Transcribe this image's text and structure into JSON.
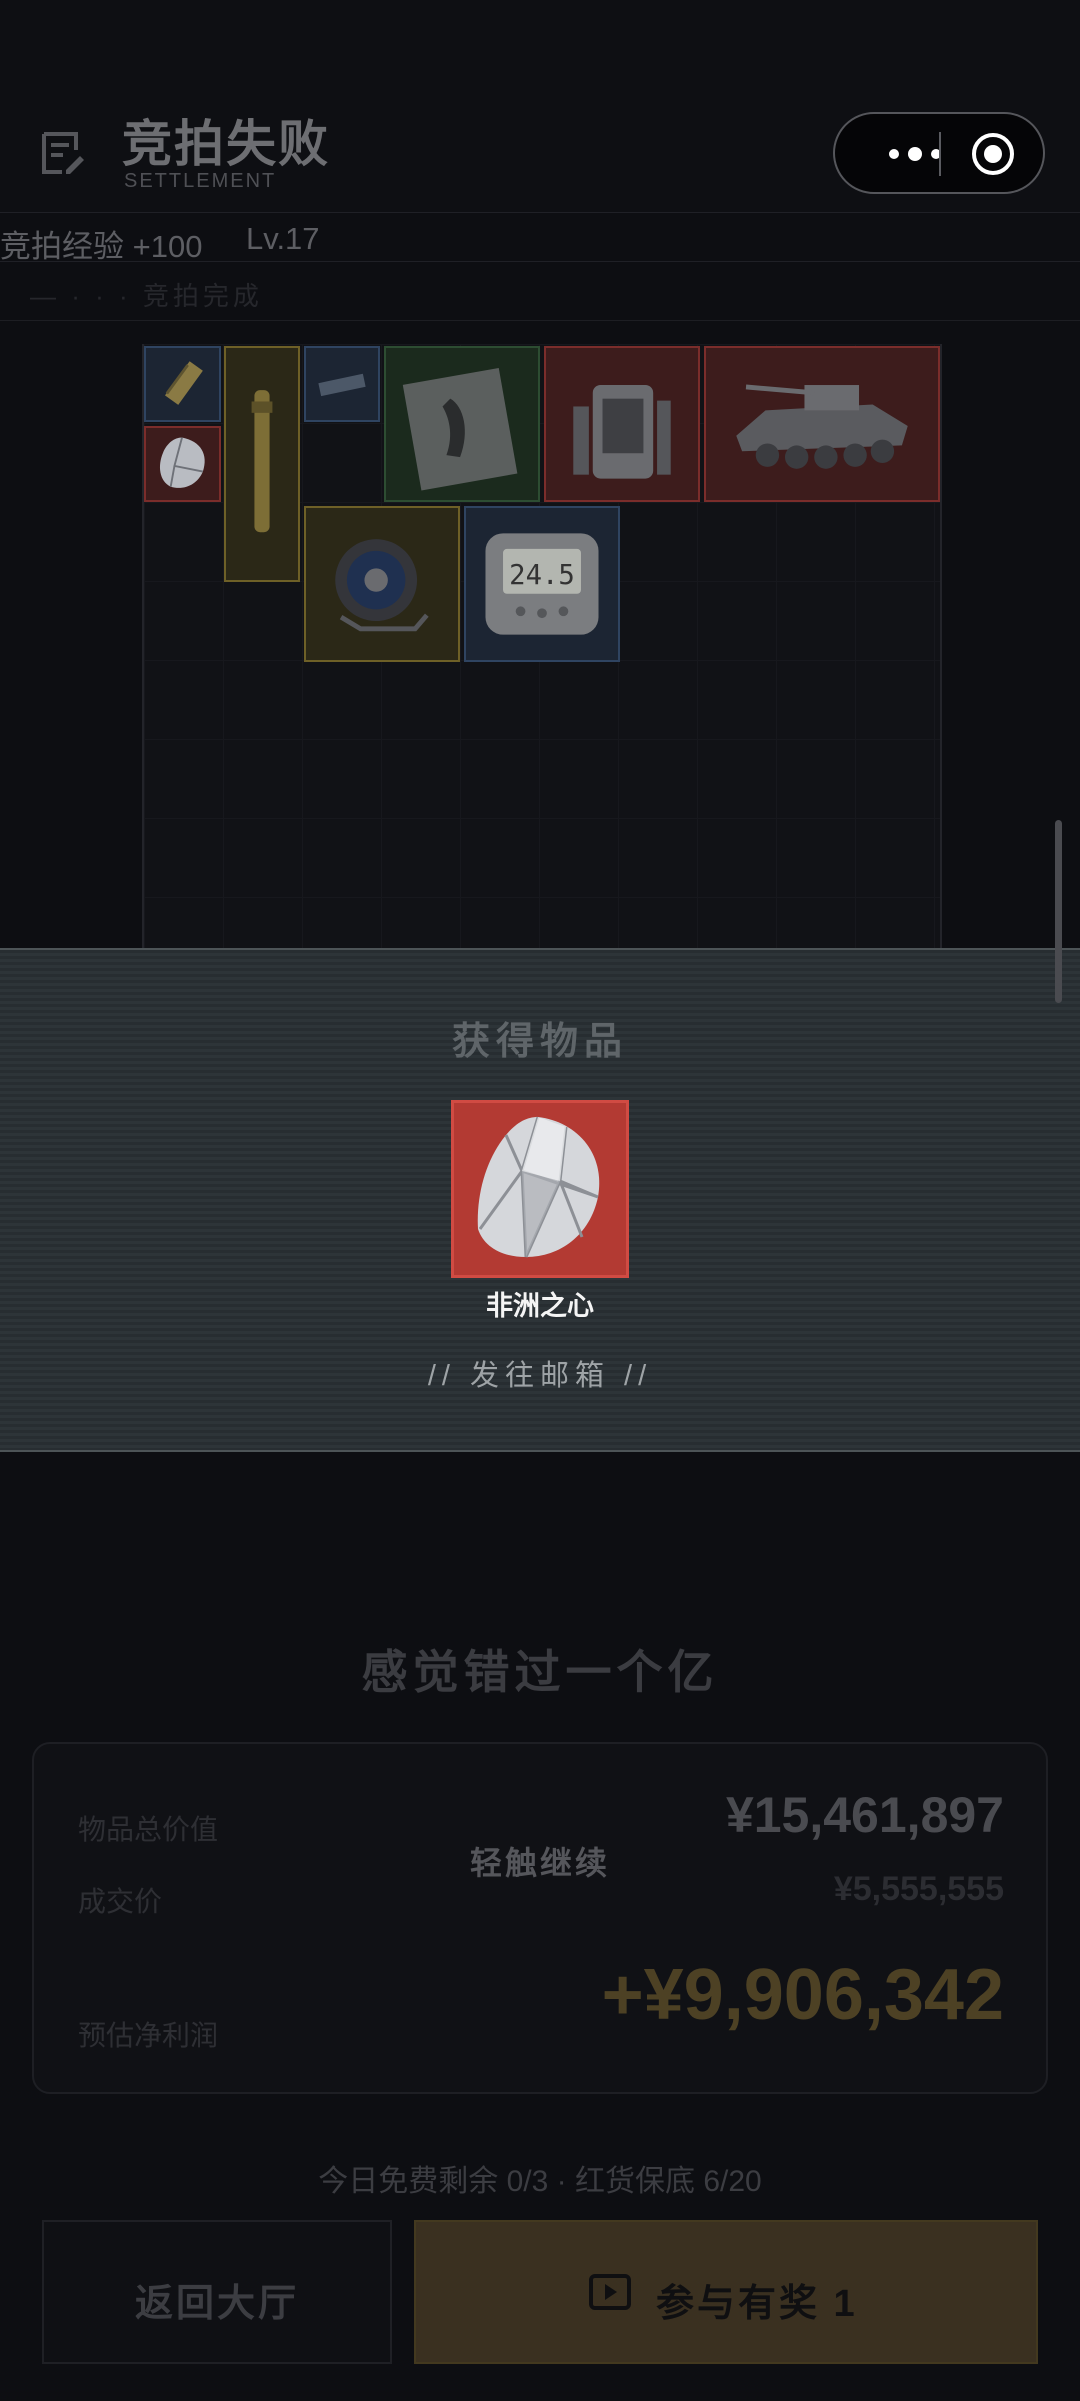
{
  "header": {
    "title": "竞拍失败",
    "subtitle": "SETTLEMENT",
    "xp_text": "竞拍经验 +100",
    "level_text": "Lv.17",
    "faint_text": "— · · · 竞拍完成"
  },
  "stash": {
    "items": [
      {
        "icon": "snack-bar-icon",
        "rarity": "blue"
      },
      {
        "icon": "diamond-icon",
        "rarity": "red"
      },
      {
        "icon": "tube-icon",
        "rarity": "yellow"
      },
      {
        "icon": "battery-pack-icon",
        "rarity": "blue"
      },
      {
        "icon": "magazine-icon",
        "rarity": "green"
      },
      {
        "icon": "backpack-device-icon",
        "rarity": "red"
      },
      {
        "icon": "armored-vehicle-icon",
        "rarity": "red"
      },
      {
        "icon": "cable-reel-icon",
        "rarity": "yellow"
      },
      {
        "icon": "digital-meter-icon",
        "rarity": "blue"
      }
    ],
    "meter_reading": "24.5"
  },
  "obtained": {
    "title": "获得物品",
    "item_name": "非洲之心",
    "item_icon": "heart-of-africa-diamond-icon",
    "mail_note": "// 发往邮箱 //"
  },
  "result": {
    "quote": "感觉错过一个亿",
    "total_value_label": "物品总价值",
    "total_value": "¥15,461,897",
    "deal_price_label": "成交价",
    "deal_price": "¥5,555,555",
    "net_profit_label": "预估净利润",
    "net_profit": "+¥9,906,342",
    "tap_continue": "轻触继续",
    "free_remaining": "今日免费剩余 0/3 · 红货保底 6/20"
  },
  "buttons": {
    "back_lobby": "返回大厅",
    "join_reward": "参与有奖 1"
  },
  "colors": {
    "accent_gold": "#4d4124",
    "rarity_red": "#b33a33",
    "panel": "#2b3236"
  }
}
